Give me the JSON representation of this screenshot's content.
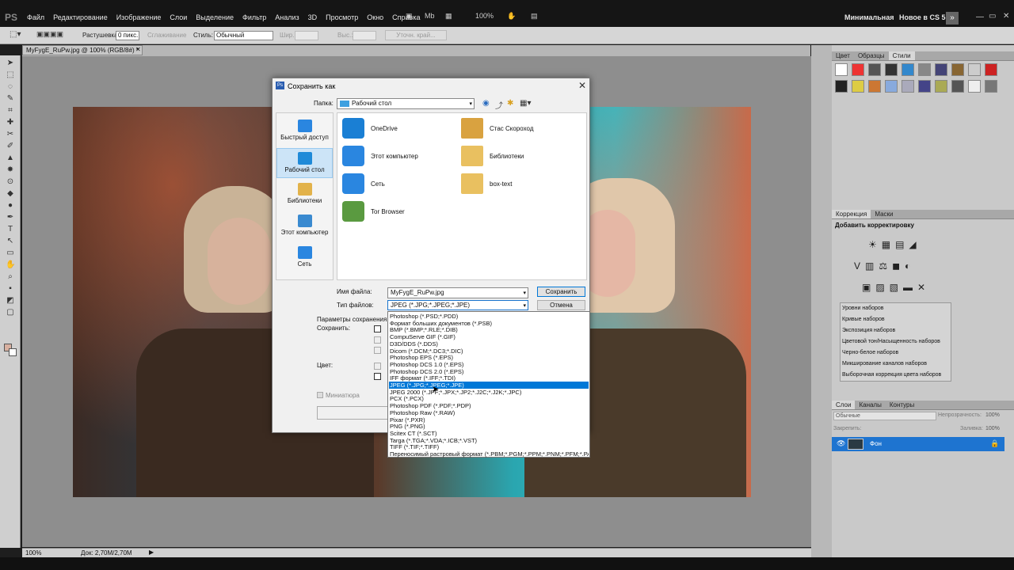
{
  "app": {
    "logo": "PS"
  },
  "menus": [
    "Файл",
    "Редактирование",
    "Изображение",
    "Слои",
    "Выделение",
    "Фильтр",
    "Анализ",
    "3D",
    "Просмотр",
    "Окно",
    "Справка"
  ],
  "topbar": {
    "zoom": "100%",
    "workspace1": "Минимальная",
    "workspace2": "Новое в CS 5"
  },
  "options": {
    "feather_label": "Растушевка:",
    "feather_value": "0 пикс.",
    "antialias": "Сглаживание",
    "style_label": "Стиль:",
    "style_value": "Обычный",
    "width_label": "Шир.:",
    "height_label": "Выс.:",
    "refine": "Уточн. край..."
  },
  "document": {
    "tab": "MyFygE_RuPw.jpg @ 100% (RGB/8#) *",
    "close": "✕"
  },
  "status": {
    "zoom": "100%",
    "doc": "Док: 2,70M/2,70M"
  },
  "panels": {
    "styles_tabs": [
      "Цвет",
      "Образцы",
      "Стили"
    ],
    "adjust_tabs": [
      "Коррекция",
      "Маски"
    ],
    "adjust_title": "Добавить корректировку",
    "presets": [
      "Уровни наборов",
      "Кривые наборов",
      "Экспозиция наборов",
      "Цветовой тон/Насыщенность наборов",
      "Черно-белое наборов",
      "Микширование каналов наборов",
      "Выборочная коррекция цвета наборов"
    ],
    "layers_tabs": [
      "Слои",
      "Каналы",
      "Контуры"
    ],
    "blend": "Обычные",
    "opacity_label": "Непрозрачность:",
    "opacity": "100%",
    "lock_label": "Закрепить:",
    "fill_label": "Заливка:",
    "fill": "100%",
    "layer_name": "Фон"
  },
  "dialog": {
    "title": "Сохранить как",
    "folder_label": "Папка:",
    "folder_value": "Рабочий стол",
    "places": [
      "Быстрый доступ",
      "Рабочий стол",
      "Библиотеки",
      "Этот компьютер",
      "Сеть"
    ],
    "files_left": [
      "OneDrive",
      "Этот компьютер",
      "Сеть",
      "Tor Browser"
    ],
    "files_right": [
      "Стас Скороход",
      "Библиотеки",
      "box-text"
    ],
    "filename_label": "Имя файла:",
    "filename": "MyFygE_RuPw.jpg",
    "filetype_label": "Тип файлов:",
    "filetype": "JPEG (*.JPG;*.JPEG;*.JPE)",
    "save": "Сохранить",
    "cancel": "Отмена",
    "params": "Параметры сохранения",
    "save_label": "Сохранить:",
    "color_label": "Цвет:",
    "thumbnail": "Миниатюра",
    "types": [
      "Photoshop (*.PSD;*.PDD)",
      "Формат больших документов (*.PSB)",
      "BMP (*.BMP;*.RLE;*.DIB)",
      "CompuServe GIF (*.GIF)",
      "D3D/DDS (*.DDS)",
      "Dicom (*.DCM;*.DC3;*.DIC)",
      "Photoshop EPS (*.EPS)",
      "Photoshop DCS 1.0 (*.EPS)",
      "Photoshop DCS 2.0 (*.EPS)",
      "IFF формат (*.IFF;*.TDI)",
      "JPEG (*.JPG;*.JPEG;*.JPE)",
      "JPEG 2000 (*.JPF;*.JPX;*.JP2;*.J2C;*.J2K;*.JPC)",
      "PCX (*.PCX)",
      "Photoshop PDF (*.PDF;*.PDP)",
      "Photoshop Raw (*.RAW)",
      "Pixar (*.PXR)",
      "PNG (*.PNG)",
      "Scitex CT (*.SCT)",
      "Targa (*.TGA;*.VDA;*.ICB;*.VST)",
      "TIFF (*.TIF;*.TIFF)",
      "Переносимый растровый формат (*.PBM;*.PGM;*.PPM;*.PNM;*.PFM;*.PAM)"
    ],
    "selected_type_index": 10
  },
  "colors": {
    "accent": "#0078d7",
    "layer_sel": "#1e74d0"
  }
}
